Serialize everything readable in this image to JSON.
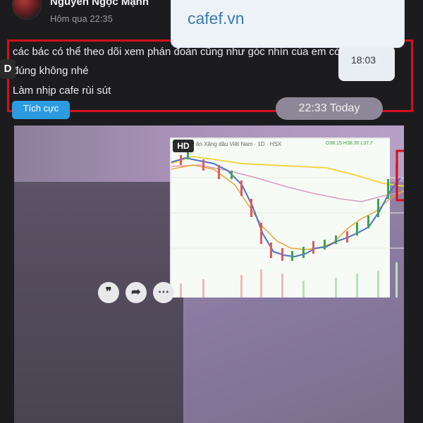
{
  "post": {
    "author": "Nguyen Ngọc Mạnh",
    "time": "Hôm qua 22:35",
    "more_icon": "more-horizontal-icon",
    "text_lines": [
      "các bác có thể theo dõi xem phán đoán cũng như góc nhìn của em có",
      "đúng không nhé",
      "Làm nhịp cafe rùi sút"
    ],
    "tag": "Tích cực",
    "highlight_color": "#d2101b",
    "tag_color": "#2d9be0"
  },
  "photo": {
    "site": "cafef.vn",
    "msg_time": "18:03",
    "divider_time": "22:33 Today",
    "badge_d": "D",
    "badge_hd": "HD",
    "chart_title": "ăn Xăng dầu Việt Nam · 1D · HSX",
    "chart_values": "O38.15 H38.30 L37.7",
    "buttons": [
      "quote-icon",
      "share-icon",
      "more-icon"
    ]
  }
}
